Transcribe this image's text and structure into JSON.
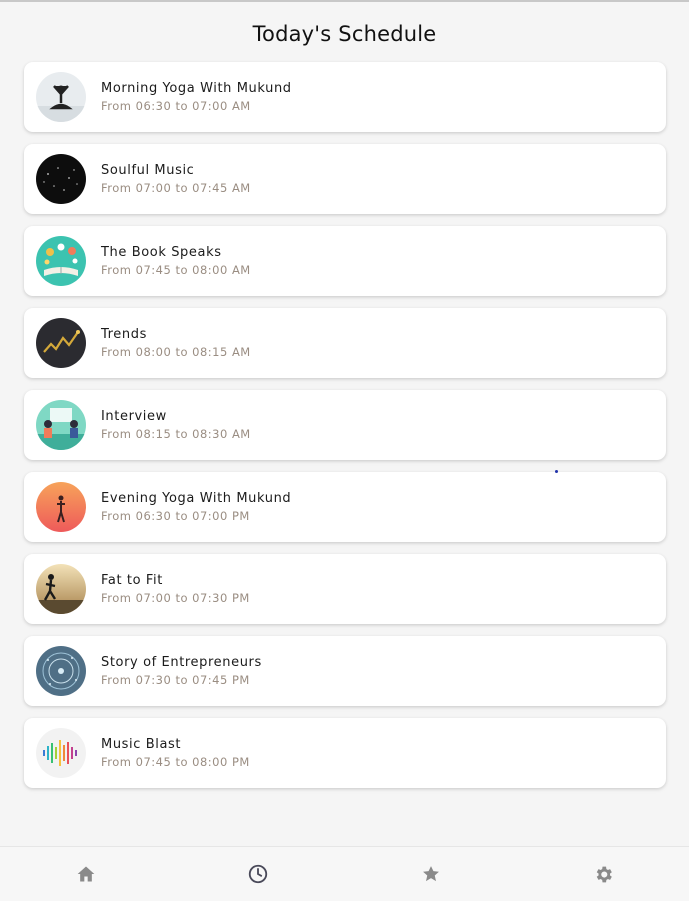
{
  "header": {
    "title": "Today's Schedule"
  },
  "schedule": [
    {
      "name": "Morning Yoga With Mukund",
      "time": "From 06:30 to 07:00 AM",
      "icon": "yoga-morning-thumbnail"
    },
    {
      "name": "Soulful Music",
      "time": "From 07:00 to 07:45 AM",
      "icon": "soulful-music-thumbnail"
    },
    {
      "name": "The Book Speaks",
      "time": "From 07:45 to 08:00 AM",
      "icon": "book-thumbnail"
    },
    {
      "name": "Trends",
      "time": "From 08:00 to 08:15 AM",
      "icon": "trends-thumbnail"
    },
    {
      "name": "Interview",
      "time": "From 08:15 to 08:30 AM",
      "icon": "interview-thumbnail"
    },
    {
      "name": "Evening Yoga With Mukund",
      "time": "From 06:30 to 07:00 PM",
      "icon": "yoga-evening-thumbnail"
    },
    {
      "name": "Fat to Fit",
      "time": "From 07:00 to 07:30 PM",
      "icon": "running-thumbnail"
    },
    {
      "name": "Story of Entrepreneurs",
      "time": "From 07:30 to 07:45 PM",
      "icon": "entrepreneurs-thumbnail"
    },
    {
      "name": "Music Blast",
      "time": "From 07:45 to 08:00 PM",
      "icon": "music-blast-thumbnail"
    }
  ],
  "bottom_nav": {
    "items": [
      {
        "icon": "home-icon",
        "active": false
      },
      {
        "icon": "clock-icon",
        "active": true
      },
      {
        "icon": "star-icon",
        "active": false
      },
      {
        "icon": "gear-icon",
        "active": false
      }
    ]
  },
  "colors": {
    "active_nav": "#4a4a5a",
    "inactive_nav": "#8a8a8a",
    "time_text": "#9a8d82"
  }
}
